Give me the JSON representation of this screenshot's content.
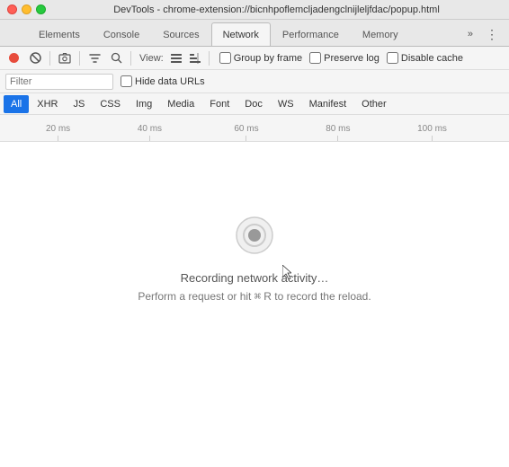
{
  "titlebar": {
    "title": "DevTools - chrome-extension://bicnhpoflemcljadengclnijleljfdac/popup.html"
  },
  "tabs": [
    {
      "id": "elements",
      "label": "Elements",
      "active": false
    },
    {
      "id": "console",
      "label": "Console",
      "active": false
    },
    {
      "id": "sources",
      "label": "Sources",
      "active": false
    },
    {
      "id": "network",
      "label": "Network",
      "active": true
    },
    {
      "id": "performance",
      "label": "Performance",
      "active": false
    },
    {
      "id": "memory",
      "label": "Memory",
      "active": false
    }
  ],
  "toolbar": {
    "view_label": "View:",
    "group_by_frame_label": "Group by frame",
    "preserve_log_label": "Preserve log",
    "disable_cache_label": "Disable cache"
  },
  "filter_bar": {
    "filter_placeholder": "Filter",
    "hide_data_urls_label": "Hide data URLs"
  },
  "type_tabs": [
    {
      "id": "all",
      "label": "All",
      "active": true
    },
    {
      "id": "xhr",
      "label": "XHR",
      "active": false
    },
    {
      "id": "js",
      "label": "JS",
      "active": false
    },
    {
      "id": "css",
      "label": "CSS",
      "active": false
    },
    {
      "id": "img",
      "label": "Img",
      "active": false
    },
    {
      "id": "media",
      "label": "Media",
      "active": false
    },
    {
      "id": "font",
      "label": "Font",
      "active": false
    },
    {
      "id": "doc",
      "label": "Doc",
      "active": false
    },
    {
      "id": "ws",
      "label": "WS",
      "active": false
    },
    {
      "id": "manifest",
      "label": "Manifest",
      "active": false
    },
    {
      "id": "other",
      "label": "Other",
      "active": false
    }
  ],
  "timeline": {
    "ticks": [
      {
        "label": "20 ms",
        "left_pct": 9
      },
      {
        "label": "40 ms",
        "left_pct": 27
      },
      {
        "label": "60 ms",
        "left_pct": 46
      },
      {
        "label": "80 ms",
        "left_pct": 64
      },
      {
        "label": "100 ms",
        "left_pct": 82
      }
    ]
  },
  "main": {
    "recording_text": "Recording network activity…",
    "recording_hint_prefix": "Perform a request or hit ",
    "recording_hint_key": "⌘",
    "recording_hint_r": " R",
    "recording_hint_suffix": " to record the reload."
  }
}
